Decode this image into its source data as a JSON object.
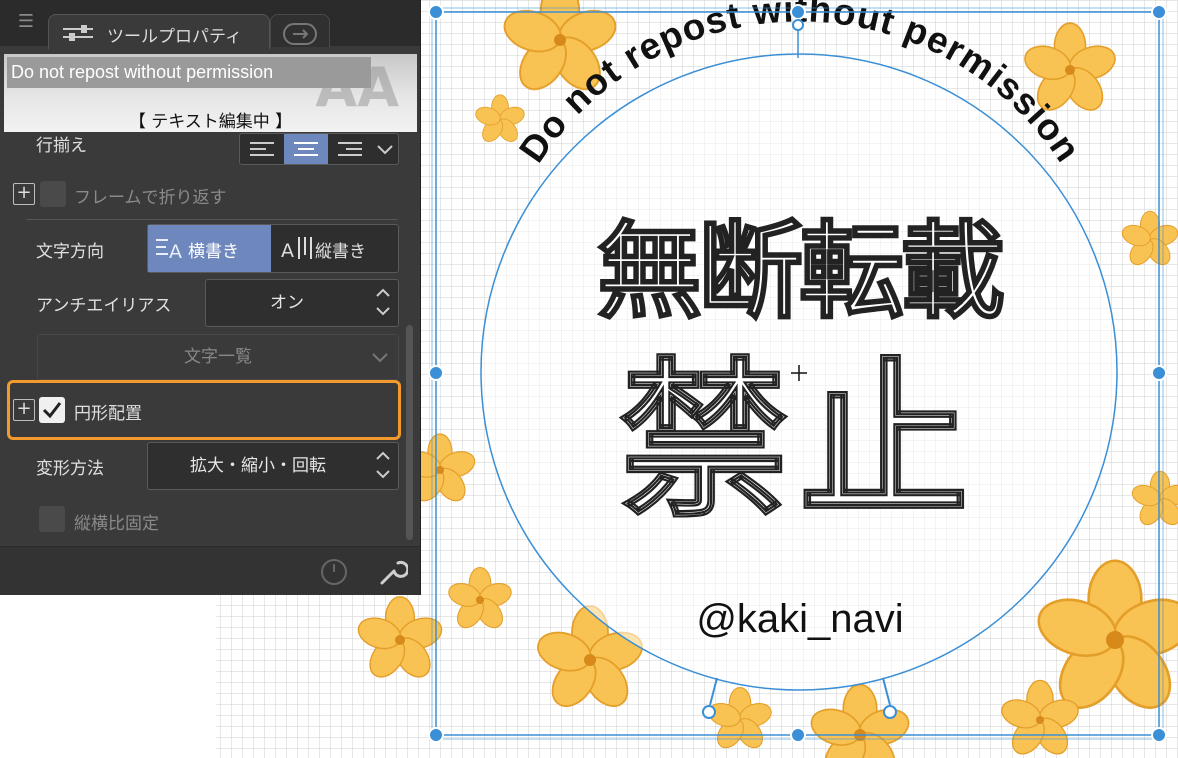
{
  "panel": {
    "tab_title": "ツールプロパティ",
    "preview": {
      "input_text": "Do not repost without permission",
      "status": "【 テキスト編集中 】"
    },
    "alignment_label": "行揃え",
    "frame_wrap_label": "フレームで折り返す",
    "text_direction": {
      "label": "文字方向",
      "horizontal": "横書き",
      "vertical": "縦書き",
      "selected": "horizontal"
    },
    "antialias": {
      "label": "アンチエイリアス",
      "value": "オン"
    },
    "char_list_label": "文字一覧",
    "circular": {
      "label": "円形配置",
      "checked": true
    },
    "transform": {
      "label": "変形方法",
      "value": "拡大・縮小・回転"
    },
    "aspect_lock_label": "縦横比固定"
  },
  "canvas": {
    "arc_text": "Do not repost without permission",
    "title_line1": "無断転載",
    "title_line2": "禁止",
    "handle_text": "@kaki_navi"
  },
  "colors": {
    "accent": "#6e87bd",
    "highlight": "#f29a2e",
    "selection": "#3a8fd6",
    "flower": "#f7b733"
  }
}
